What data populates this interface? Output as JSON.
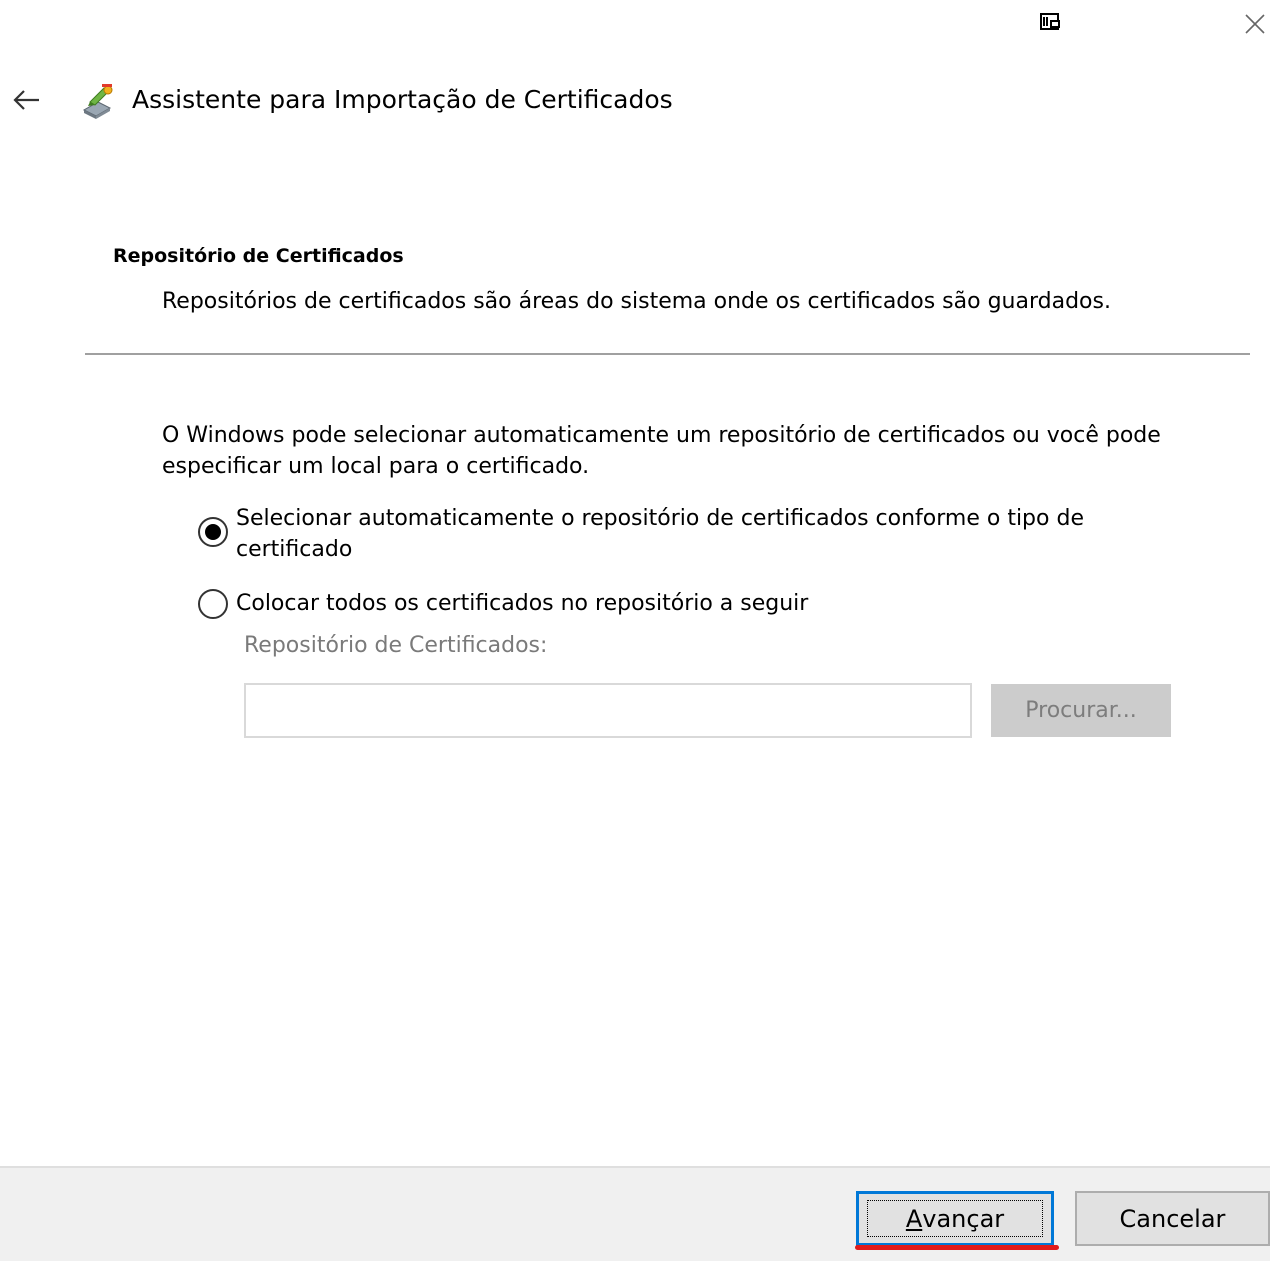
{
  "window": {
    "title": "Assistente para Importação de Certificados",
    "icons": {
      "window_menu": "window-icon",
      "close": "close-icon",
      "back": "back-arrow-icon",
      "wizard": "certificate-wizard-icon"
    }
  },
  "header": {
    "section_title": "Repositório de Certificados",
    "section_description": "Repositórios de certificados são áreas do sistema onde os certificados são guardados."
  },
  "content": {
    "intro": "O Windows pode selecionar automaticamente um repositório de certificados ou você pode especificar um local para o certificado.",
    "options": [
      {
        "label": "Selecionar automaticamente o repositório de certificados conforme o tipo de certificado",
        "selected": true
      },
      {
        "label": "Colocar todos os certificados no repositório a seguir",
        "selected": false
      }
    ],
    "store_label": "Repositório de Certificados:",
    "store_value": "",
    "browse_label": "Procurar..."
  },
  "footer": {
    "next_label": "Avançar",
    "next_mnemonic": "A",
    "next_rest": "vançar",
    "cancel_label": "Cancelar"
  },
  "colors": {
    "accent": "#0078d7",
    "highlight": "#e01b1b",
    "footer_bg": "#f0f0f0",
    "disabled_text": "#7a7a7a"
  }
}
